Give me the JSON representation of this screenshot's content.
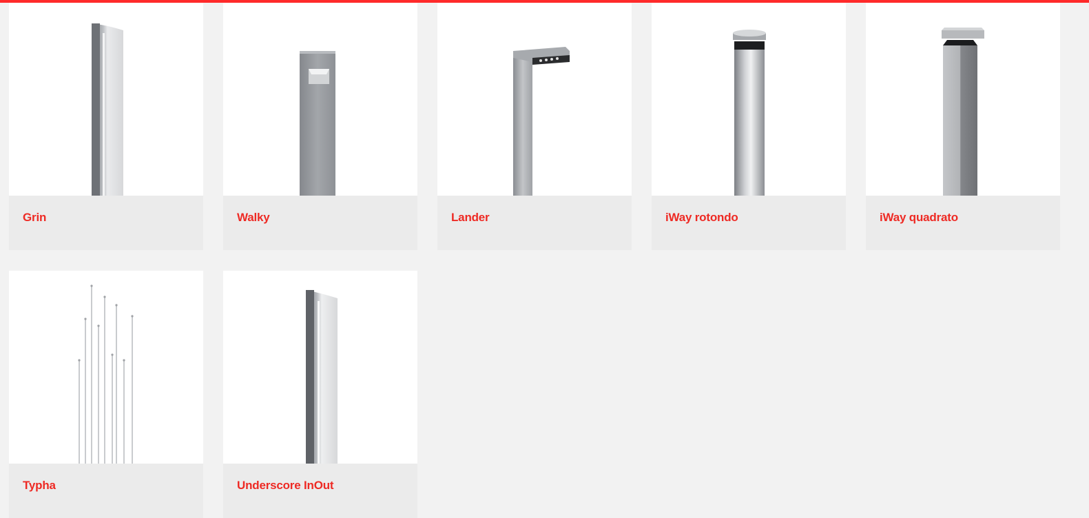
{
  "accent_color": "#ee2a24",
  "products": [
    {
      "name": "Grin",
      "icon": "curved-bollard-icon"
    },
    {
      "name": "Walky",
      "icon": "square-bollard-recessed-light-icon"
    },
    {
      "name": "Lander",
      "icon": "l-shaped-bollard-icon"
    },
    {
      "name": "iWay rotondo",
      "icon": "round-bollard-icon"
    },
    {
      "name": "iWay quadrato",
      "icon": "square-bollard-icon"
    },
    {
      "name": "Typha",
      "icon": "thin-stems-light-icon"
    },
    {
      "name": "Underscore InOut",
      "icon": "curved-bollard-icon"
    }
  ]
}
